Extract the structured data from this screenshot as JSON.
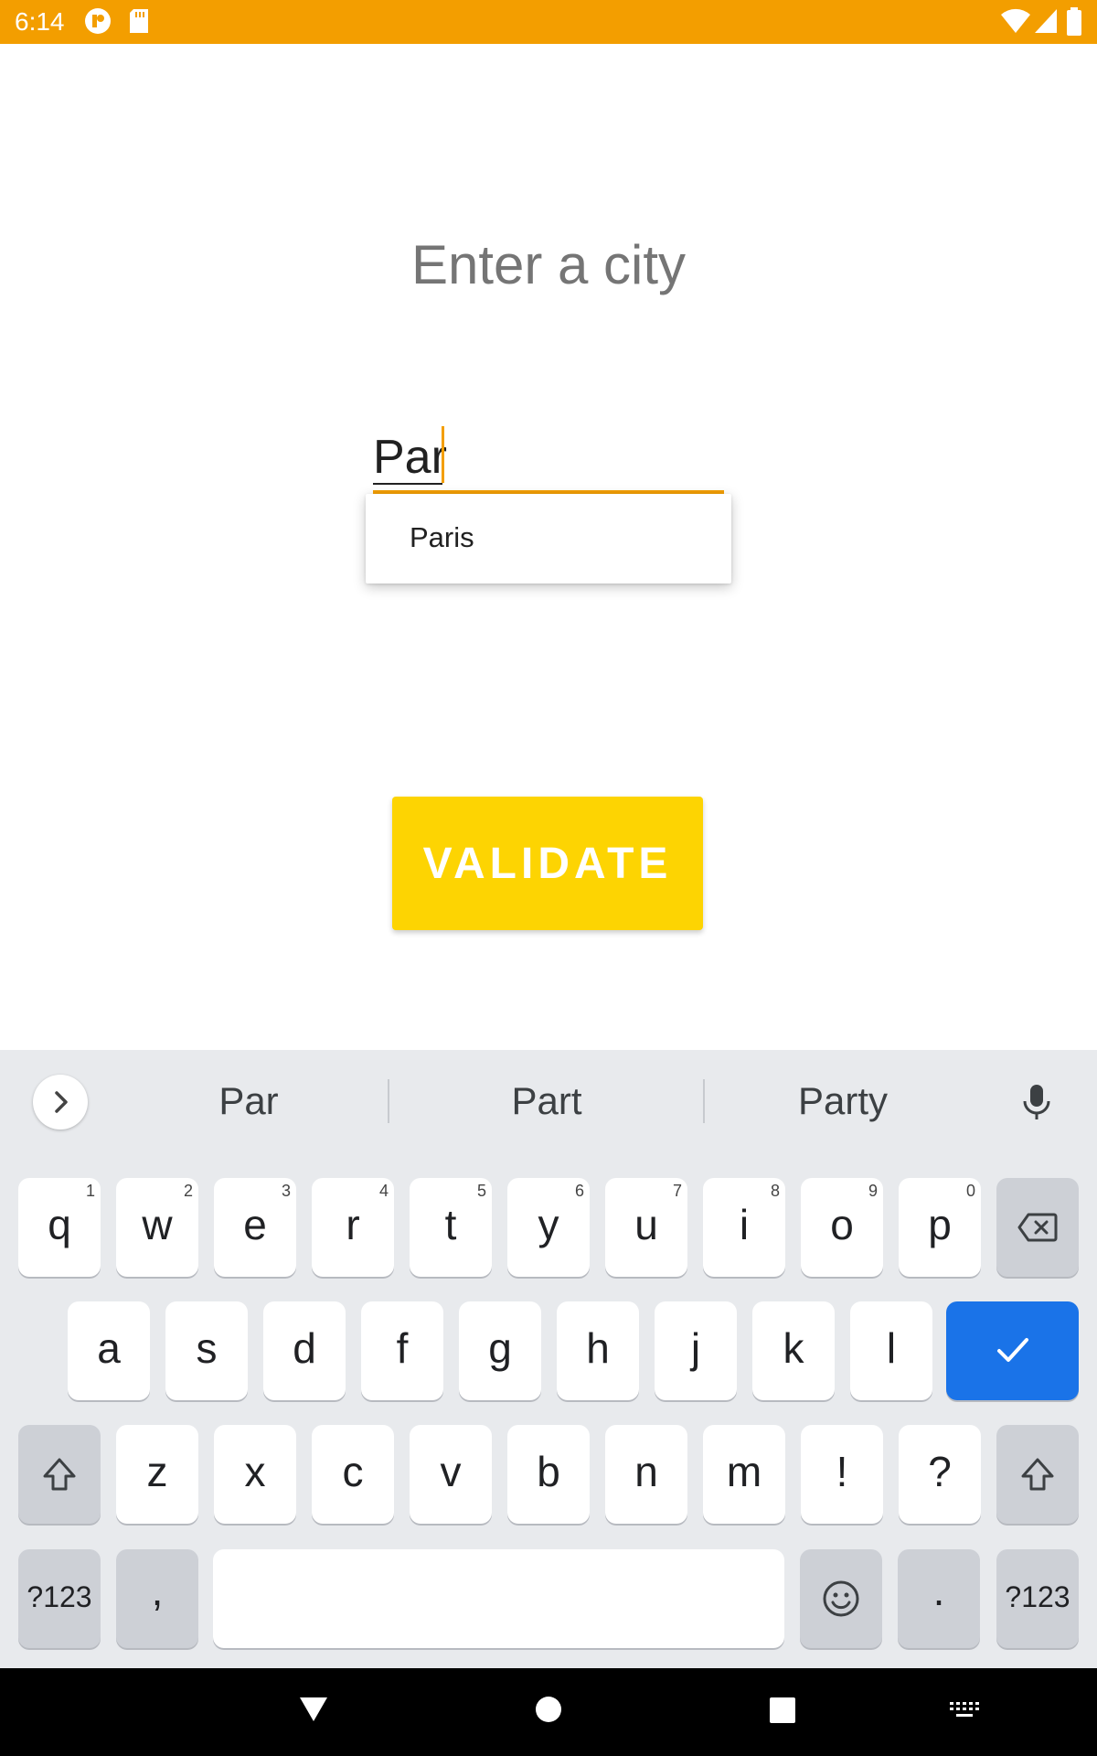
{
  "status_bar": {
    "time": "6:14",
    "icons": [
      "notification-r-icon",
      "sd-card-icon",
      "wifi-icon",
      "signal-icon",
      "battery-icon"
    ],
    "color": "#F39E00"
  },
  "main": {
    "title": "Enter a city",
    "city_input": {
      "value": "Par"
    },
    "suggestion_dropdown": {
      "items": [
        "Paris"
      ]
    },
    "validate_label": "VALIDATE",
    "accent_color": "#F39E00",
    "button_color": "#FDD402"
  },
  "keyboard": {
    "suggestions": [
      "Par",
      "Part",
      "Party"
    ],
    "row1": [
      {
        "k": "q",
        "h": "1"
      },
      {
        "k": "w",
        "h": "2"
      },
      {
        "k": "e",
        "h": "3"
      },
      {
        "k": "r",
        "h": "4"
      },
      {
        "k": "t",
        "h": "5"
      },
      {
        "k": "y",
        "h": "6"
      },
      {
        "k": "u",
        "h": "7"
      },
      {
        "k": "i",
        "h": "8"
      },
      {
        "k": "o",
        "h": "9"
      },
      {
        "k": "p",
        "h": "0"
      }
    ],
    "row2": [
      "a",
      "s",
      "d",
      "f",
      "g",
      "h",
      "j",
      "k",
      "l"
    ],
    "row3": [
      "z",
      "x",
      "c",
      "v",
      "b",
      "n",
      "m",
      "!",
      "?"
    ],
    "symbols_label": "?123",
    "comma": ",",
    "period": "."
  },
  "nav_bar": {
    "icons": [
      "back-triangle-icon",
      "home-circle-icon",
      "recents-square-icon",
      "keyboard-switch-icon"
    ]
  }
}
